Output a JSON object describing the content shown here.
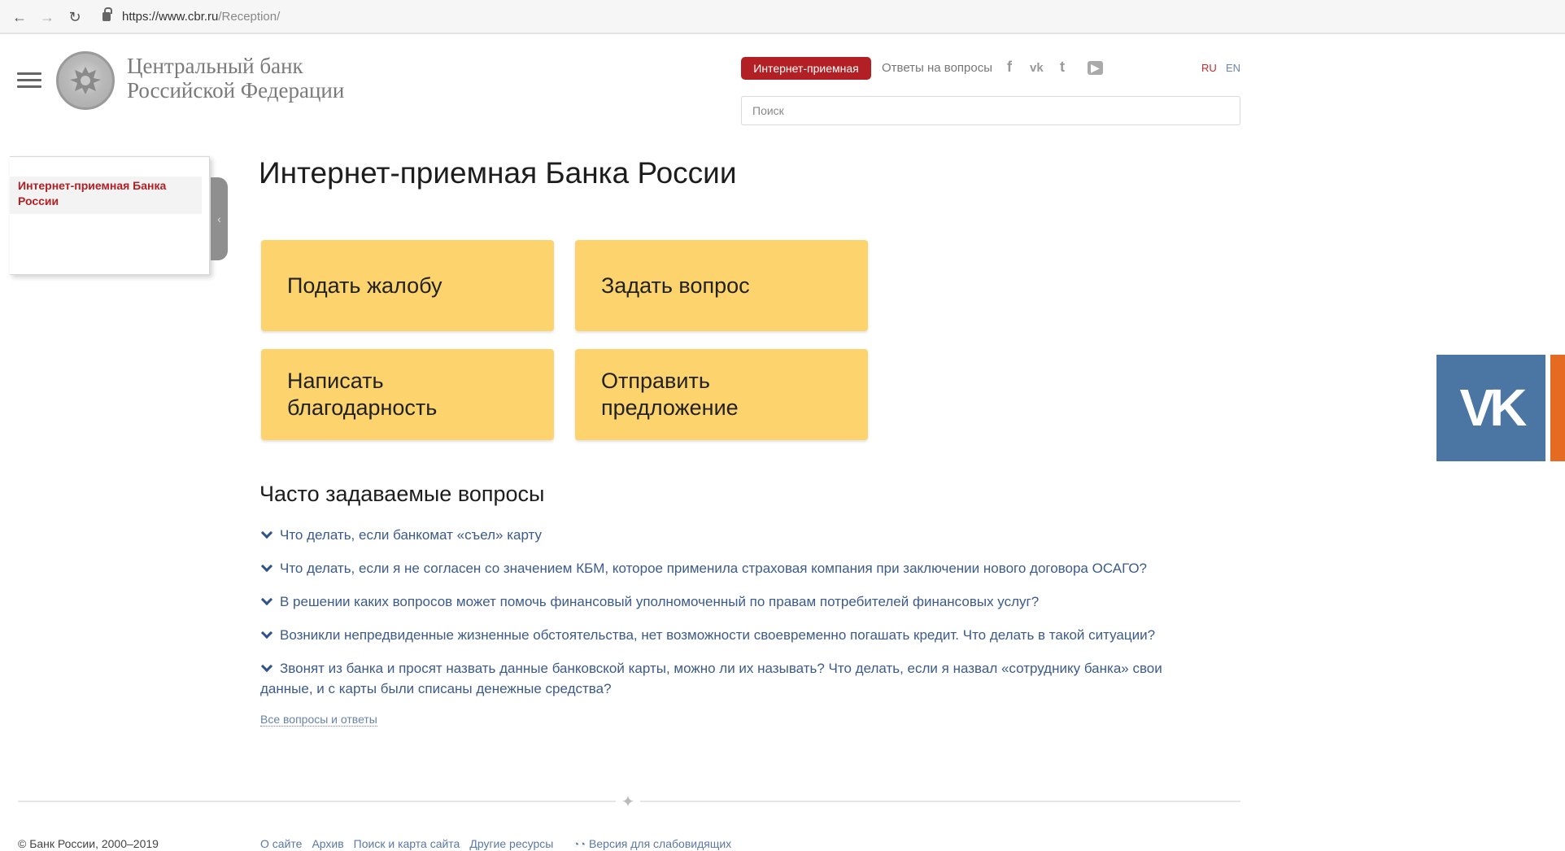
{
  "browser": {
    "url_host": "https://www.cbr.ru",
    "url_path": "/Reception/"
  },
  "header": {
    "bank_name_line1": "Центральный банк",
    "bank_name_line2": "Российской Федерации",
    "reception_button": "Интернет-приемная",
    "faq_link": "Ответы на вопросы",
    "social": {
      "facebook": "f",
      "vk": "vk",
      "twitter": "t",
      "youtube": "▶"
    },
    "lang_ru": "RU",
    "lang_en": "EN",
    "search_placeholder": "Поиск"
  },
  "sidebar": {
    "items": [
      {
        "label": "Интернет-приемная Банка России"
      }
    ]
  },
  "main": {
    "title": "Интернет-приемная Банка России",
    "tiles": [
      {
        "label": "Подать жалобу"
      },
      {
        "label": "Задать вопрос"
      },
      {
        "label": "Написать благодарность"
      },
      {
        "label": "Отправить предложение"
      }
    ],
    "faq_title": "Часто задаваемые вопросы",
    "faq": [
      "Что делать, если банкомат «съел» карту",
      "Что делать, если я не согласен со значением КБМ, которое применила страховая компания при заключении нового договора ОСАГО?",
      "В решении каких вопросов может помочь финансовый уполномоченный по правам потребителей финансовых услуг?",
      "Возникли непредвиденные жизненные обстоятельства, нет возможности своевременно погашать кредит. Что делать в такой ситуации?",
      "Звонят из банка и просят назвать данные банковской карты, можно ли их называть? Что делать, если я назвал «сотруднику банка» свои данные, и с карты были списаны денежные средства?"
    ],
    "all_faq_link": "Все вопросы и ответы"
  },
  "footer": {
    "copyright": "© Банк России, 2000–2019",
    "links": [
      "О сайте",
      "Архив",
      "Поиск и карта сайта",
      "Другие ресурсы"
    ],
    "accessibility": "Версия для слабовидящих"
  },
  "vk_widget": {
    "label": "VK"
  },
  "colors": {
    "accent_red": "#b21f24",
    "tile_yellow": "#fcd36d",
    "link_blue": "#3c5b8a",
    "vk_blue": "#4b76a4"
  }
}
